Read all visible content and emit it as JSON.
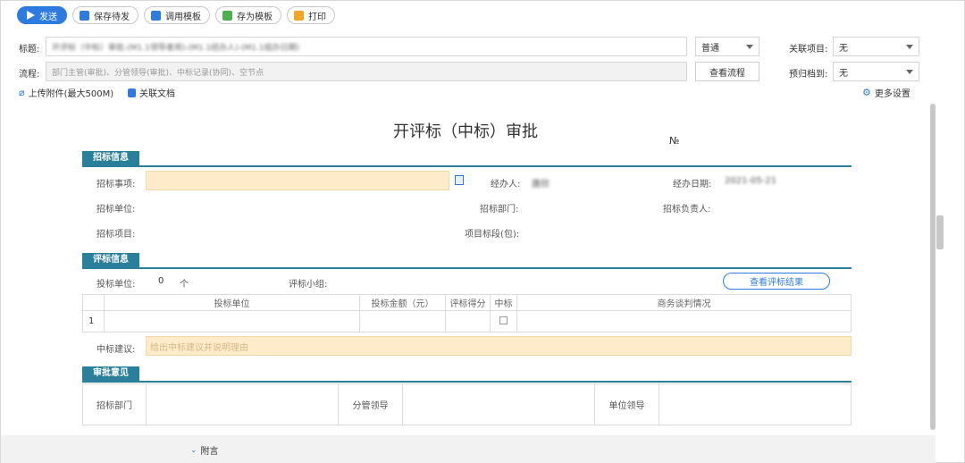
{
  "toolbar": {
    "send": "发送",
    "save_pending": "保存待发",
    "use_template": "调用模板",
    "save_template": "存为模板",
    "print": "打印"
  },
  "header": {
    "title_label": "标题:",
    "title_value": "开评标（中标）审批-(M1.1领导者用)-(M1.1经办人)-(M1.1组办日期)",
    "priority_value": "普通",
    "related_project_label": "关联项目:",
    "related_project_value": "无",
    "flow_label": "流程:",
    "flow_value": "部门主管(审批)、分管领导(审批)、中标记录(协同)、空节点",
    "view_flow": "查看流程",
    "archive_label": "预归档到:",
    "archive_value": "无",
    "upload": "上传附件(最大500M)",
    "related_doc": "关联文档",
    "more_settings": "更多设置"
  },
  "form": {
    "title": "开评标（中标）审批",
    "no": "№",
    "sec1": "招标信息",
    "bid_item_label": "招标事项:",
    "handler_label": "经办人:",
    "handler_value": "唐欣",
    "handle_date_label": "经办日期:",
    "handle_date_value": "2021-05-21",
    "bid_unit_label": "招标单位:",
    "bid_dept_label": "招标部门:",
    "bid_owner_label": "招标负责人:",
    "bid_project_label": "招标项目:",
    "project_section_label": "项目标段(包):",
    "sec2": "评标信息",
    "bidder_count_label": "投标单位:",
    "bidder_count_value": "0",
    "bidder_count_unit": "个",
    "eval_group_label": "评标小组:",
    "view_result": "查看评标结果",
    "table_headers": [
      "投标单位",
      "投标金额（元）",
      "评标得分",
      "中标",
      "商务谈判情况"
    ],
    "row_no": "1",
    "suggest_label": "中标建议:",
    "suggest_placeholder": "给出中标建议并说明理由",
    "sec3": "审批意见",
    "approve_dept": "招标部门",
    "approve_leader": "分管领导",
    "approve_unit": "单位领导"
  },
  "footer": {
    "attach_word": "附言"
  }
}
